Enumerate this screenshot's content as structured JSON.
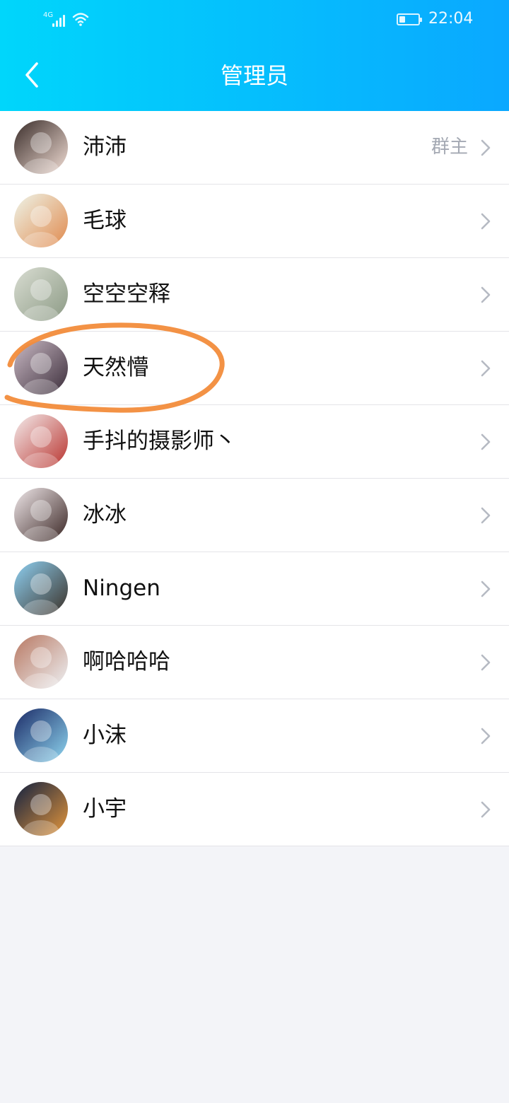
{
  "status_bar": {
    "network": "4G",
    "time": "22:04",
    "battery_level": 0.3
  },
  "header": {
    "title": "管理员",
    "back_icon": "chevron-left-icon"
  },
  "members": [
    {
      "name": "沛沛",
      "role": "群主",
      "avatar_colors": [
        "#3a2d2a",
        "#f1ddd4"
      ]
    },
    {
      "name": "毛球",
      "role": "",
      "avatar_colors": [
        "#eef4e8",
        "#e08a4e"
      ]
    },
    {
      "name": "空空空释",
      "role": "",
      "avatar_colors": [
        "#d9ddd2",
        "#8c9a85"
      ]
    },
    {
      "name": "天然懵",
      "role": "",
      "avatar_colors": [
        "#c9b9c4",
        "#3b2d3a"
      ]
    },
    {
      "name": "手抖的摄影师丶",
      "role": "",
      "avatar_colors": [
        "#f4ecec",
        "#b9342f"
      ]
    },
    {
      "name": "冰冰",
      "role": "",
      "avatar_colors": [
        "#f0e8ea",
        "#3a2624"
      ]
    },
    {
      "name": "Ningen",
      "role": "",
      "avatar_colors": [
        "#8ed0f2",
        "#3b3128"
      ]
    },
    {
      "name": "啊哈哈哈",
      "role": "",
      "avatar_colors": [
        "#b87862",
        "#eef1f4"
      ]
    },
    {
      "name": "小沫",
      "role": "",
      "avatar_colors": [
        "#1b2a66",
        "#8fd6f0"
      ]
    },
    {
      "name": "小宇",
      "role": "",
      "avatar_colors": [
        "#112040",
        "#e4963c"
      ]
    }
  ],
  "colors": {
    "header_gradient_start": "#00d6fb",
    "header_gradient_end": "#0aa8ff",
    "annotation": "#f28c3b",
    "role_text": "#a4a9b3"
  }
}
